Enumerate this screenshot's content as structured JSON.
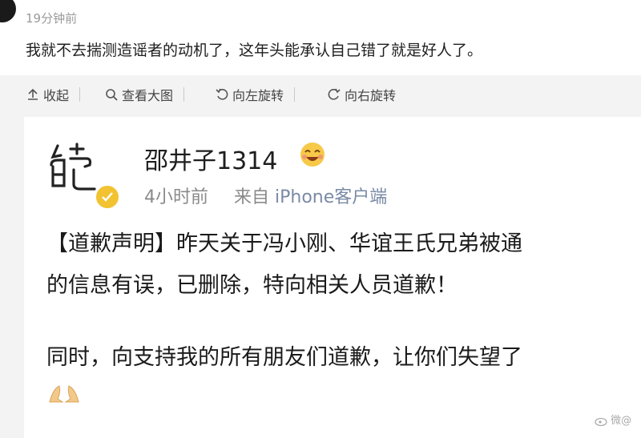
{
  "comment": {
    "time": "19分钟前",
    "text": "我就不去揣测造谣者的动机了，这年头能承认自己错了就是好人了。"
  },
  "toolbar": {
    "collapse_label": "收起",
    "view_large_label": "查看大图",
    "rotate_left_label": "向左旋转",
    "rotate_right_label": "向右旋转"
  },
  "post": {
    "username": "邵井子1314",
    "time": "4小时前",
    "source_prefix": "来自",
    "source": "iPhone客户端",
    "lines": [
      "【道歉声明】昨天关于冯小刚、华谊王氏兄弟被通",
      "的信息有误，已删除，特向相关人员道歉！",
      "同时，向支持我的所有朋友们道歉，让你们失望了"
    ]
  },
  "watermark": "微@"
}
